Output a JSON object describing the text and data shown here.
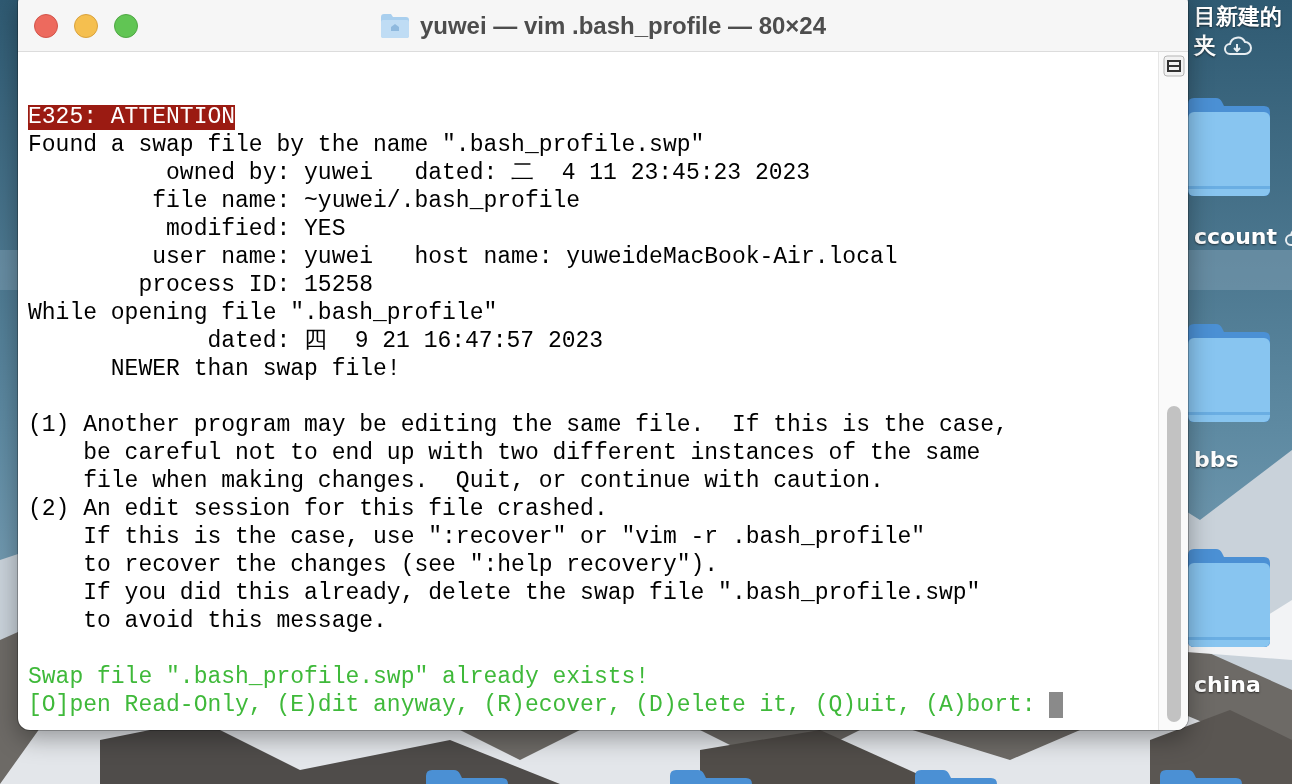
{
  "desktop": {
    "labels": [
      {
        "text": "目新建的",
        "cloud": false
      },
      {
        "text": "夹",
        "cloud": true
      },
      {
        "text": "ccount",
        "cloud": true
      },
      {
        "text": "bbs",
        "cloud": false
      },
      {
        "text": "china",
        "cloud": false
      }
    ]
  },
  "window": {
    "title": "yuwei — vim .bash_profile — 80×24"
  },
  "terminal": {
    "lines": [
      {
        "kind": "error",
        "text": "E325: ATTENTION"
      },
      {
        "kind": "normal",
        "text": "Found a swap file by the name \".bash_profile.swp\""
      },
      {
        "kind": "normal",
        "text": "          owned by: yuwei   dated: 二  4 11 23:45:23 2023"
      },
      {
        "kind": "normal",
        "text": "         file name: ~yuwei/.bash_profile"
      },
      {
        "kind": "normal",
        "text": "          modified: YES"
      },
      {
        "kind": "normal",
        "text": "         user name: yuwei   host name: yuweideMacBook-Air.local"
      },
      {
        "kind": "normal",
        "text": "        process ID: 15258"
      },
      {
        "kind": "normal",
        "text": "While opening file \".bash_profile\""
      },
      {
        "kind": "normal",
        "text": "             dated: 四  9 21 16:47:57 2023"
      },
      {
        "kind": "normal",
        "text": "      NEWER than swap file!"
      },
      {
        "kind": "blank"
      },
      {
        "kind": "normal",
        "text": "(1) Another program may be editing the same file.  If this is the case,"
      },
      {
        "kind": "normal",
        "text": "    be careful not to end up with two different instances of the same"
      },
      {
        "kind": "normal",
        "text": "    file when making changes.  Quit, or continue with caution."
      },
      {
        "kind": "normal",
        "text": "(2) An edit session for this file crashed."
      },
      {
        "kind": "normal",
        "text": "    If this is the case, use \":recover\" or \"vim -r .bash_profile\""
      },
      {
        "kind": "normal",
        "text": "    to recover the changes (see \":help recovery\")."
      },
      {
        "kind": "normal",
        "text": "    If you did this already, delete the swap file \".bash_profile.swp\""
      },
      {
        "kind": "normal",
        "text": "    to avoid this message."
      },
      {
        "kind": "blank"
      },
      {
        "kind": "prompt",
        "text": "Swap file \".bash_profile.swp\" already exists!",
        "cursor": false
      },
      {
        "kind": "prompt",
        "text": "[O]pen Read-Only, (E)dit anyway, (R)ecover, (D)elete it, (Q)uit, (A)bort: ",
        "cursor": true
      }
    ]
  }
}
